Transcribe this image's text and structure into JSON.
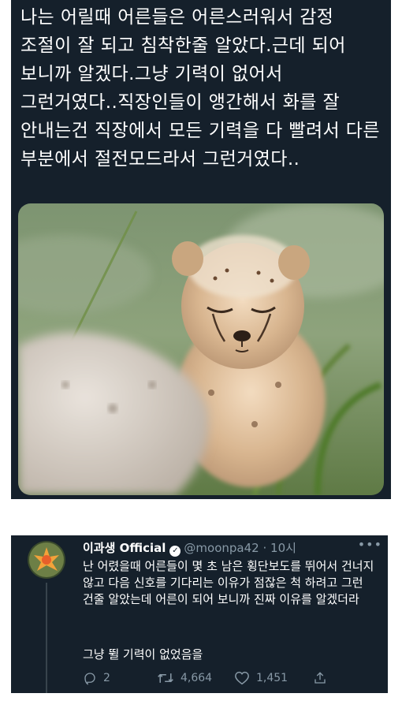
{
  "tweet": {
    "text": "나는 어릴때 어른들은 어른스러워서 감정 조절이 잘 되고 침착한줄 알았다.근데 되어 보니까 알겠다.그냥 기력이 없어서 그런거였다..직장인들이 앵간해서 화를 잘 안내는건 직장에서 모든 기력을 다 빨려서 다른 부분에서 절전모드라서 그런거였다..",
    "image_icon": "cheetah-cub-photo"
  },
  "reply": {
    "author_name": "이과생 Official",
    "handle": "@moonpa42",
    "separator": "·",
    "timestamp": "10시",
    "body": "난 어렸을때 어른들이 몇 초 남은 횡단보도를 뛰어서 건너지 않고 다음 신호를 기다리는 이유가 점잖은 척 하려고 그런 건줄 알았는데 어른이 되어 보니까 진짜 이유를 알겠더라",
    "body2": "그냥 뛸 기력이 없었음을",
    "actions": {
      "reply_count": "2",
      "retweet_count": "4,664",
      "like_count": "1,451"
    }
  },
  "colors": {
    "panel_bg": "#15202b",
    "muted_text": "#8899a6",
    "text": "#ffffff"
  }
}
